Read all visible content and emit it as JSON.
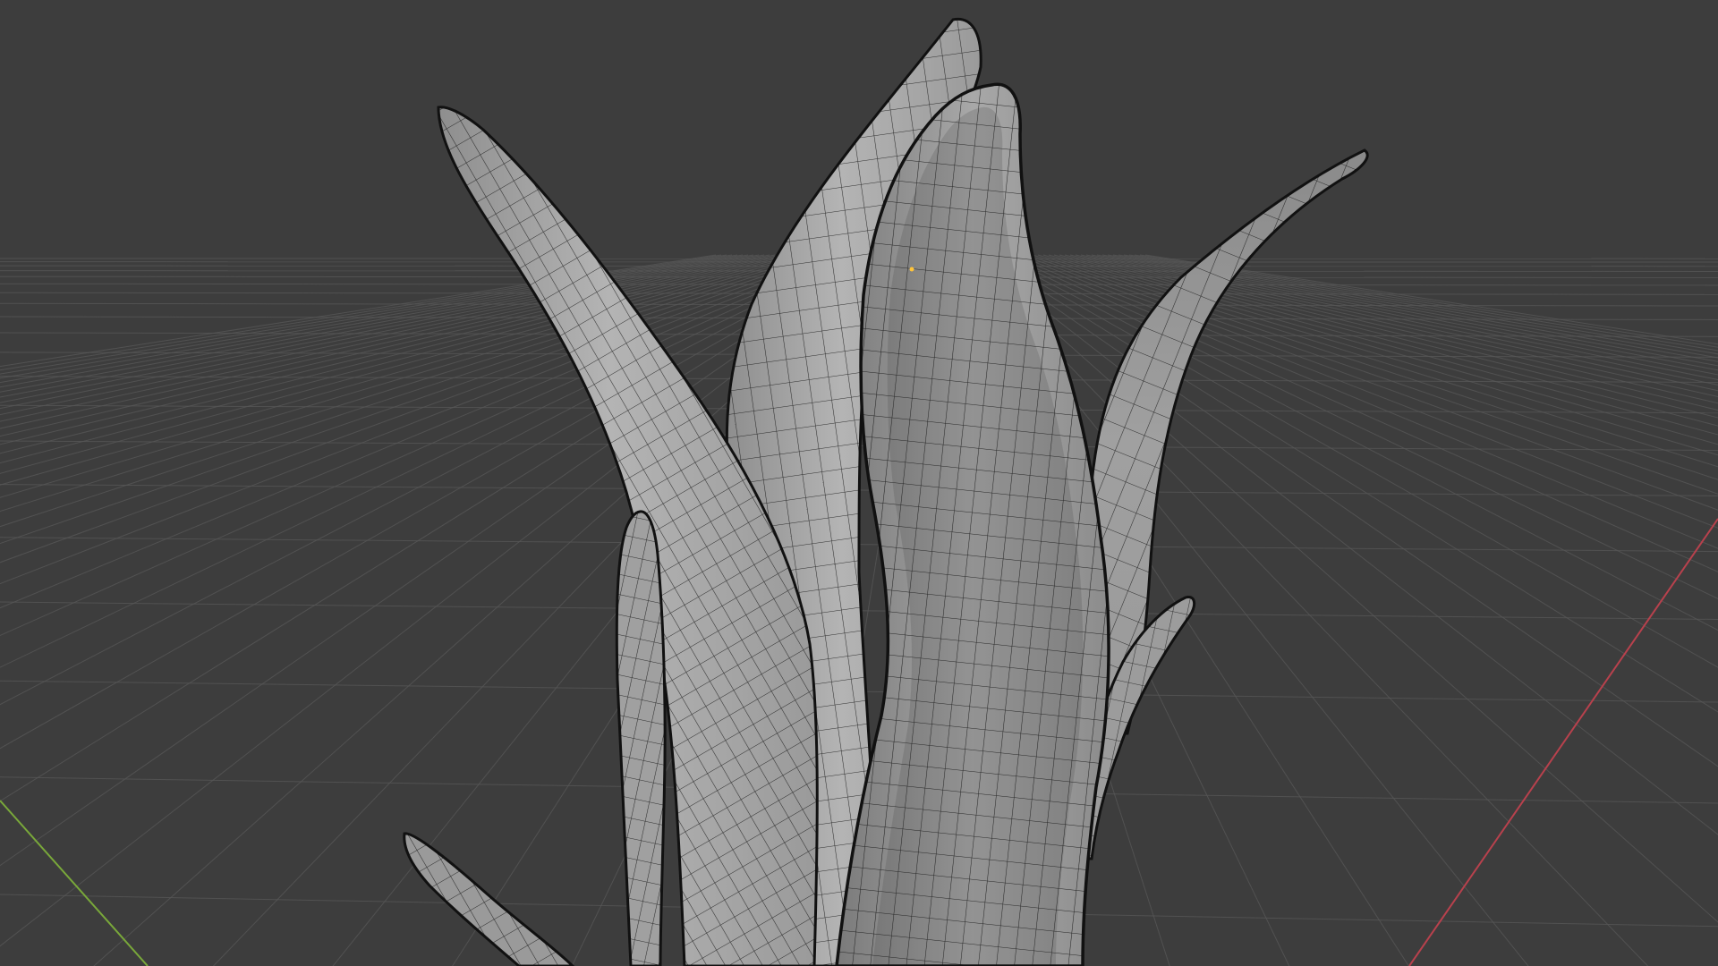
{
  "app": "3D Viewport",
  "viewport": {
    "background_color": "#3d3d3d",
    "grid_line_color": "#575757",
    "x_axis_color": "#b8414d",
    "y_axis_color": "#79a83a",
    "mesh_fill_color": "#a6a6a6",
    "mesh_wire_color": "#151515",
    "selected_vertex_color": "#ffc43a"
  },
  "scene": {
    "object_kind": "plant-leaves-mesh",
    "leaf_count": 7,
    "display_mode": "solid-with-wireframe-overlay"
  }
}
